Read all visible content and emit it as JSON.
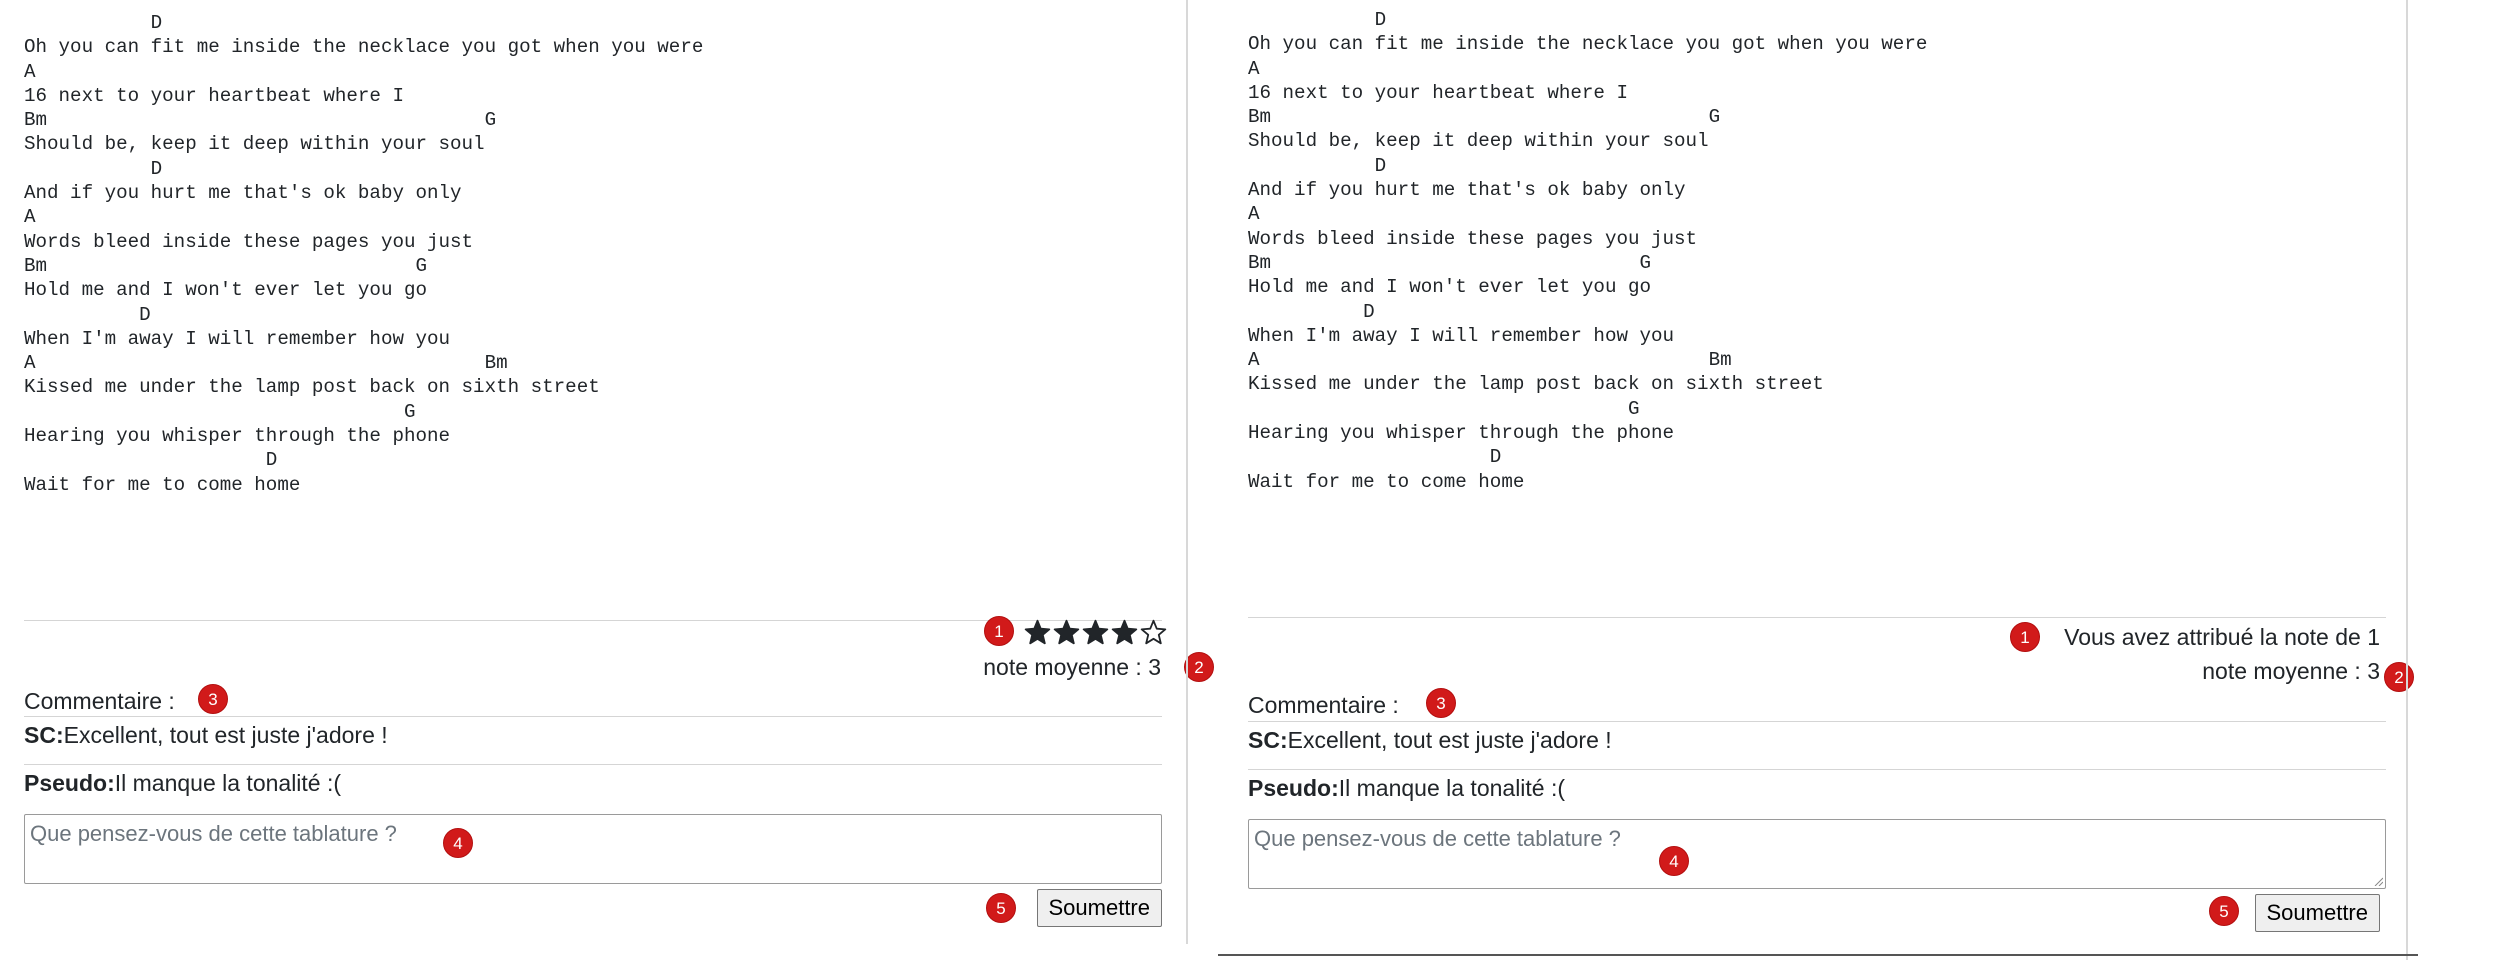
{
  "left": {
    "tab_lines": [
      "           D",
      "Oh you can fit me inside the necklace you got when you were",
      "A",
      "16 next to your heartbeat where I",
      "Bm                                      G",
      "Should be, keep it deep within your soul",
      "           D",
      "And if you hurt me that's ok baby only",
      "A",
      "Words bleed inside these pages you just",
      "Bm                                G",
      "Hold me and I won't ever let you go",
      "          D",
      "When I'm away I will remember how you",
      "A                                       Bm",
      "Kissed me under the lamp post back on sixth street",
      "                                 G",
      "Hearing you whisper through the phone",
      "                     D",
      "Wait for me to come home"
    ],
    "rating": {
      "value": 4,
      "max": 5,
      "badge": "1"
    },
    "average": {
      "text": "note moyenne : 3",
      "badge": "2"
    },
    "comments": {
      "label": "Commentaire :",
      "badge": "3",
      "items": [
        {
          "author": "SC:",
          "text": "Excellent, tout est juste j'adore !"
        },
        {
          "author": "Pseudo:",
          "text": "Il manque la tonalité :("
        }
      ]
    },
    "textarea": {
      "placeholder": "Que pensez-vous de cette tablature ?",
      "badge": "4"
    },
    "submit": {
      "label": "Soumettre",
      "badge": "5"
    }
  },
  "right": {
    "tab_lines": [
      "           D",
      "Oh you can fit me inside the necklace you got when you were",
      "A",
      "16 next to your heartbeat where I",
      "Bm                                      G",
      "Should be, keep it deep within your soul",
      "           D",
      "And if you hurt me that's ok baby only",
      "A",
      "Words bleed inside these pages you just",
      "Bm                                G",
      "Hold me and I won't ever let you go",
      "          D",
      "When I'm away I will remember how you",
      "A                                       Bm",
      "Kissed me under the lamp post back on sixth street",
      "                                 G",
      "Hearing you whisper through the phone",
      "                     D",
      "Wait for me to come home"
    ],
    "rating_message": {
      "text": "Vous avez attribué la note de 1",
      "badge": "1"
    },
    "average": {
      "text": "note moyenne : 3",
      "badge": "2"
    },
    "comments": {
      "label": "Commentaire :",
      "badge": "3",
      "items": [
        {
          "author": "SC:",
          "text": "Excellent, tout est juste j'adore !"
        },
        {
          "author": "Pseudo:",
          "text": "Il manque la tonalité :("
        }
      ]
    },
    "textarea": {
      "placeholder": "Que pensez-vous de cette tablature ?",
      "badge": "4"
    },
    "submit": {
      "label": "Soumettre",
      "badge": "5"
    }
  },
  "colors": {
    "badge": "#d11a1a",
    "star": "#212529",
    "text": "#212529"
  }
}
